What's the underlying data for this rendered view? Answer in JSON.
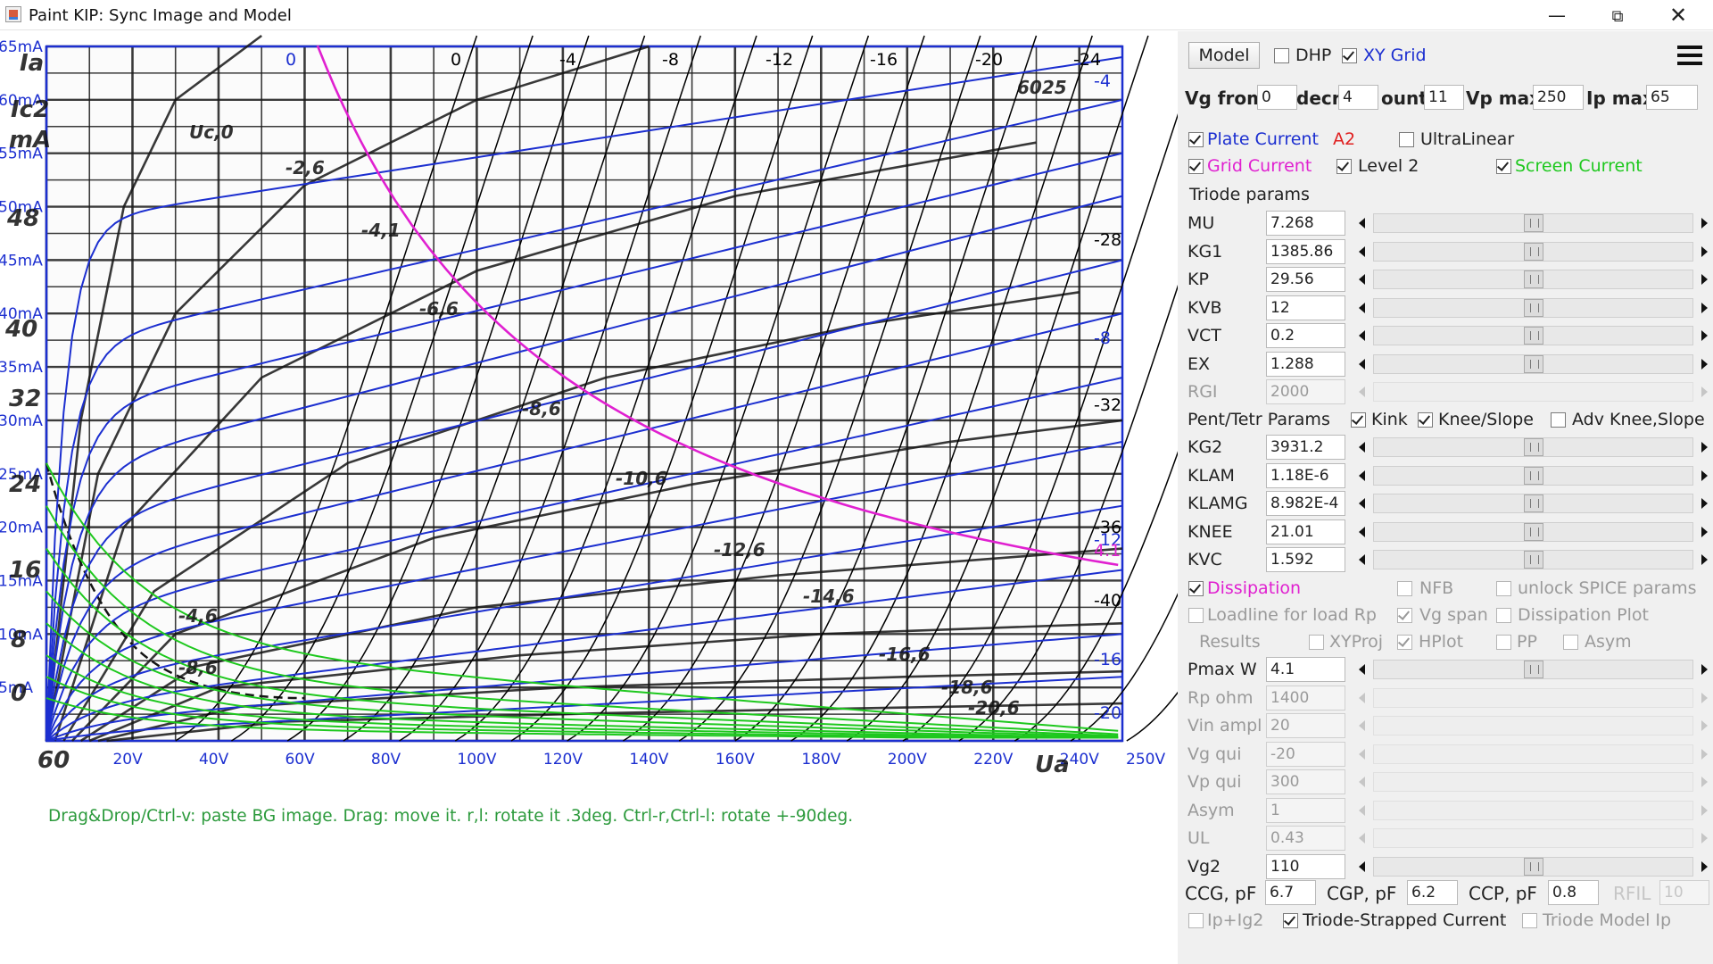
{
  "window": {
    "title": "Paint KIP: Sync Image and Model"
  },
  "plot": {
    "hint": "Drag&Drop/Ctrl-v: paste BG image. Drag: move it. r,l: rotate it .3deg. Ctrl-r,Ctrl-l: rotate +-90deg.",
    "y_labels": [
      "65mA",
      "60mA",
      "55mA",
      "50mA",
      "45mA",
      "40mA",
      "35mA",
      "30mA",
      "25mA",
      "20mA",
      "15mA",
      "10mA",
      "5mA"
    ],
    "x_labels": [
      "20V",
      "40V",
      "60V",
      "80V",
      "100V",
      "120V",
      "140V",
      "160V",
      "180V",
      "200V",
      "220V",
      "240V",
      "250V"
    ],
    "top_labels": [
      "0",
      "0",
      "-4",
      "-8",
      "-12",
      "-16",
      "-20",
      "-24"
    ],
    "right_labels": [
      "-4",
      "-28",
      "-8",
      "-32",
      "-36",
      "-12",
      "4.1",
      "-40",
      "-16",
      "-20"
    ],
    "bg_labels": [
      "Ia",
      "Ic2",
      "mA",
      "48",
      "40",
      "32",
      "24",
      "16",
      "8",
      "0",
      "60",
      "Uc,0",
      "-2,6",
      "-4,1",
      "-6,6",
      "-8,6",
      "-10,6",
      "-12,6",
      "-14,6",
      "-16,6",
      "-18,6",
      "-20,6",
      "-4,6",
      "-8,6",
      "6025",
      "Ua"
    ],
    "colors": {
      "plate": "#1c2fd0",
      "grid_current": "#e020d0",
      "screen": "#1ec81e",
      "hint": "#2c9a3c"
    }
  },
  "panel": {
    "model_button": "Model",
    "dhp": {
      "label": "DHP",
      "checked": false
    },
    "xy_grid": {
      "label": "XY Grid",
      "checked": true
    },
    "range": {
      "vg_from_label": "Vg from",
      "vg_from": "0",
      "decr_label": "decr",
      "decr": "4",
      "count_label": "ount",
      "count": "11",
      "vp_max_label": "Vp max",
      "vp_max": "250",
      "ip_max_label": "Ip max",
      "ip_max": "65"
    },
    "plate_current": {
      "label": "Plate Current",
      "checked": true,
      "tag": "A2"
    },
    "ultralinear": {
      "label": "UltraLinear",
      "checked": false
    },
    "grid_current": {
      "label": "Grid Current",
      "checked": true
    },
    "level2": {
      "label": "Level 2",
      "checked": true
    },
    "screen_current": {
      "label": "Screen Current",
      "checked": true
    },
    "triode_header": "Triode params",
    "triode_params": [
      {
        "name": "MU",
        "value": "7.268",
        "enabled": true
      },
      {
        "name": "KG1",
        "value": "1385.86",
        "enabled": true
      },
      {
        "name": "KP",
        "value": "29.56",
        "enabled": true
      },
      {
        "name": "KVB",
        "value": "12",
        "enabled": true
      },
      {
        "name": "VCT",
        "value": "0.2",
        "enabled": true
      },
      {
        "name": "EX",
        "value": "1.288",
        "enabled": true
      },
      {
        "name": "RGI",
        "value": "2000",
        "enabled": false
      }
    ],
    "pent_header": "Pent/Tetr Params",
    "kink": {
      "label": "Kink",
      "checked": true
    },
    "knee_slope": {
      "label": "Knee/Slope",
      "checked": true
    },
    "adv_knee": {
      "label": "Adv Knee,Slope",
      "checked": false
    },
    "pent_params": [
      {
        "name": "KG2",
        "value": "3931.2",
        "enabled": true
      },
      {
        "name": "KLAM",
        "value": "1.18E-6",
        "enabled": true
      },
      {
        "name": "KLAMG",
        "value": "8.982E-4",
        "enabled": true
      },
      {
        "name": "KNEE",
        "value": "21.01",
        "enabled": true
      },
      {
        "name": "KVC",
        "value": "1.592",
        "enabled": true
      }
    ],
    "dissipation": {
      "label": "Dissipation",
      "checked": true
    },
    "nfb": {
      "label": "NFB",
      "checked": false
    },
    "unlock_spice": {
      "label": "unlock SPICE params",
      "checked": false
    },
    "loadline": {
      "label": "Loadline for load Rp",
      "checked": false
    },
    "vg_span": {
      "label": "Vg span",
      "checked": true
    },
    "dissipation_plot": {
      "label": "Dissipation Plot",
      "checked": false
    },
    "results_label": "Results",
    "xyproj": {
      "label": "XYProj",
      "checked": false
    },
    "hplot": {
      "label": "HPlot",
      "checked": true
    },
    "pp": {
      "label": "PP",
      "checked": false
    },
    "asym_cb": {
      "label": "Asym",
      "checked": false
    },
    "load_params": [
      {
        "name": "Pmax W",
        "value": "4.1",
        "enabled": true
      },
      {
        "name": "Rp ohm",
        "value": "1400",
        "enabled": false
      },
      {
        "name": "Vin ampl",
        "value": "20",
        "enabled": false
      },
      {
        "name": "Vg qui",
        "value": "-20",
        "enabled": false
      },
      {
        "name": "Vp qui",
        "value": "300",
        "enabled": false
      },
      {
        "name": "Asym",
        "value": "1",
        "enabled": false
      },
      {
        "name": "UL",
        "value": "0.43",
        "enabled": false
      },
      {
        "name": "Vg2",
        "value": "110",
        "enabled": true
      }
    ],
    "caps": {
      "ccg_label": "CCG, pF",
      "ccg": "6.7",
      "cgp_label": "CGP, pF",
      "cgp": "6.2",
      "ccp_label": "CCP, pF",
      "ccp": "0.8",
      "rfil_label": "RFIL",
      "rfil": "10"
    },
    "ip_ig2": {
      "label": "Ip+Ig2",
      "checked": false
    },
    "triode_strapped": {
      "label": "Triode-Strapped Current",
      "checked": true
    },
    "triode_model_ip": {
      "label": "Triode Model Ip",
      "checked": false
    }
  }
}
